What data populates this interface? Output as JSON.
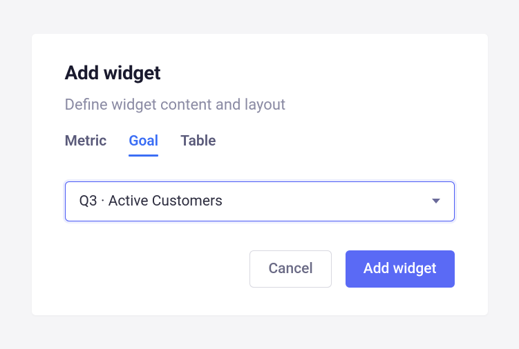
{
  "modal": {
    "title": "Add widget",
    "subtitle": "Define widget content and layout",
    "tabs": [
      {
        "label": "Metric",
        "active": false
      },
      {
        "label": "Goal",
        "active": true
      },
      {
        "label": "Table",
        "active": false
      }
    ],
    "select": {
      "value": "Q3 · Active Customers"
    },
    "actions": {
      "cancel_label": "Cancel",
      "submit_label": "Add widget"
    }
  }
}
